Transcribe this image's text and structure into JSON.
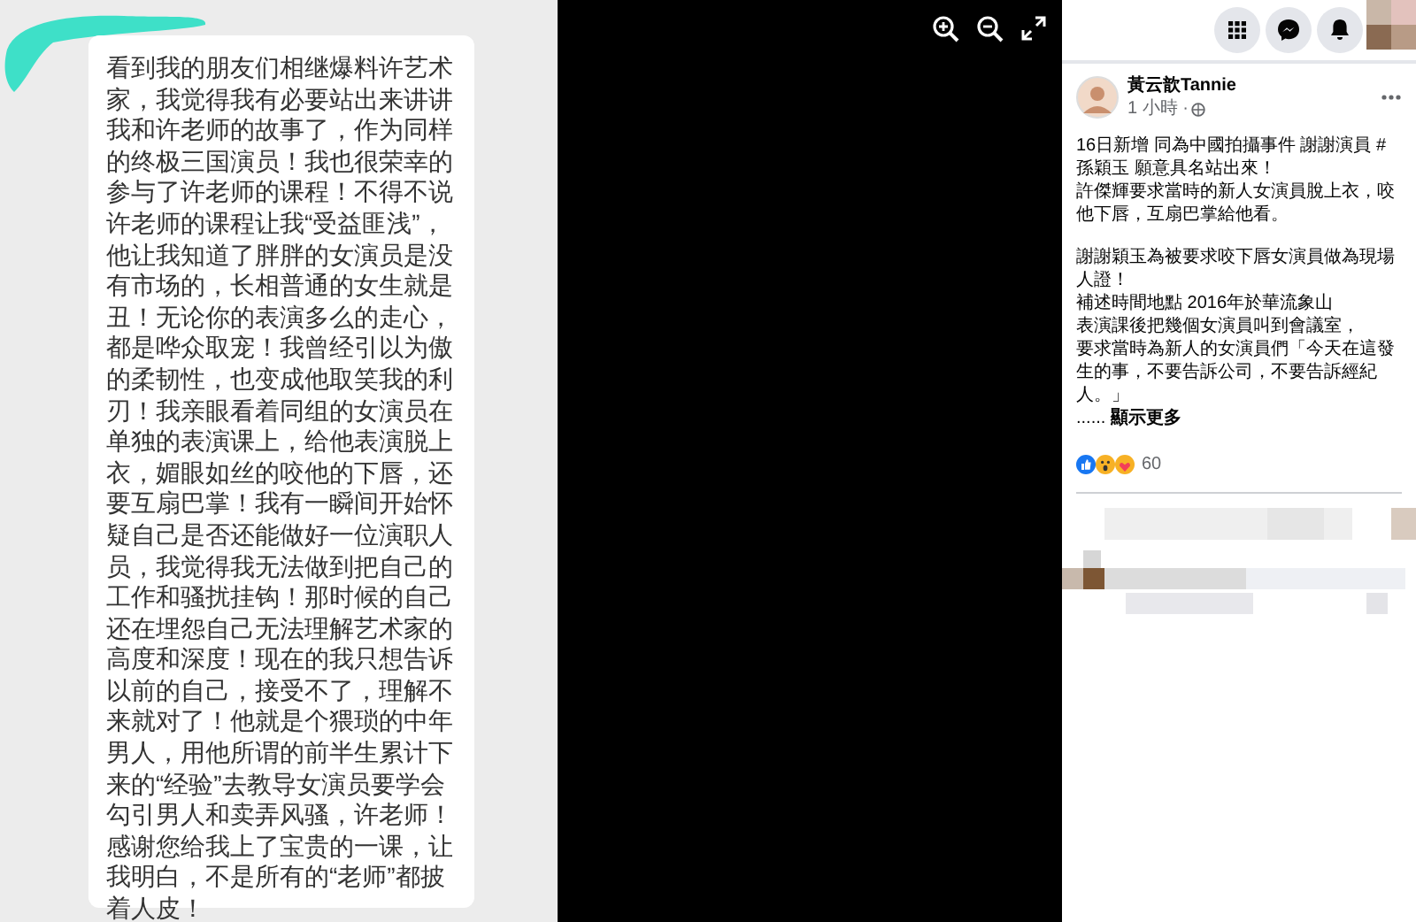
{
  "photo": {
    "message": "看到我的朋友们相继爆料许艺术家，我觉得我有必要站出来讲讲我和许老师的故事了，作为同样的终极三国演员！我也很荣幸的参与了许老师的课程！不得不说许老师的课程让我“受益匪浅”，他让我知道了胖胖的女演员是没有市场的，长相普通的女生就是丑！无论你的表演多么的走心，都是哗众取宠！我曾经引以为傲的柔韧性，也变成他取笑我的利刃！我亲眼看着同组的女演员在单独的表演课上，给他表演脱上衣，媚眼如丝的咬他的下唇，还要互扇巴掌！我有一瞬间开始怀疑自己是否还能做好一位演职人员，我觉得我无法做到把自己的工作和骚扰挂钩！那时候的自己还在埋怨自己无法理解艺术家的高度和深度！现在的我只想告诉以前的自己，接受不了，理解不来就对了！他就是个猥琐的中年男人，用他所谓的前半生累计下来的“经验”去教导女演员要学会勾引男人和卖弄风骚，许老师！感谢您给我上了宝贵的一课，让我明白，不是所有的“老师”都披着人皮！"
  },
  "viewer_controls": [
    {
      "kind": "zoom_in"
    },
    {
      "kind": "zoom_out"
    },
    {
      "kind": "fullscreen"
    }
  ],
  "top_bar": {
    "buttons": [
      {
        "kind": "menu"
      },
      {
        "kind": "messenger"
      },
      {
        "kind": "notifications"
      }
    ]
  },
  "post": {
    "author": "黃云歆Tannie",
    "time": "1 小時 ·",
    "paragraphs": [
      [
        "16日新增 同為中國拍攝事件 謝謝演員 #孫穎玉 願意具名站出來！",
        "許傑輝要求當時的新人女演員脫上衣，咬他下唇，互扇巴掌給他看。"
      ],
      [
        "謝謝穎玉為被要求咬下唇女演員做為現場人證！",
        "補述時間地點 2016年於華流象山",
        "表演課後把幾個女演員叫到會議室，",
        "要求當時為新人的女演員們「今天在這發生的事，不要告訴公司，不要告訴經紀人。」"
      ]
    ],
    "more_prefix": "......",
    "see_more": "顯示更多",
    "reaction_count": "60"
  }
}
